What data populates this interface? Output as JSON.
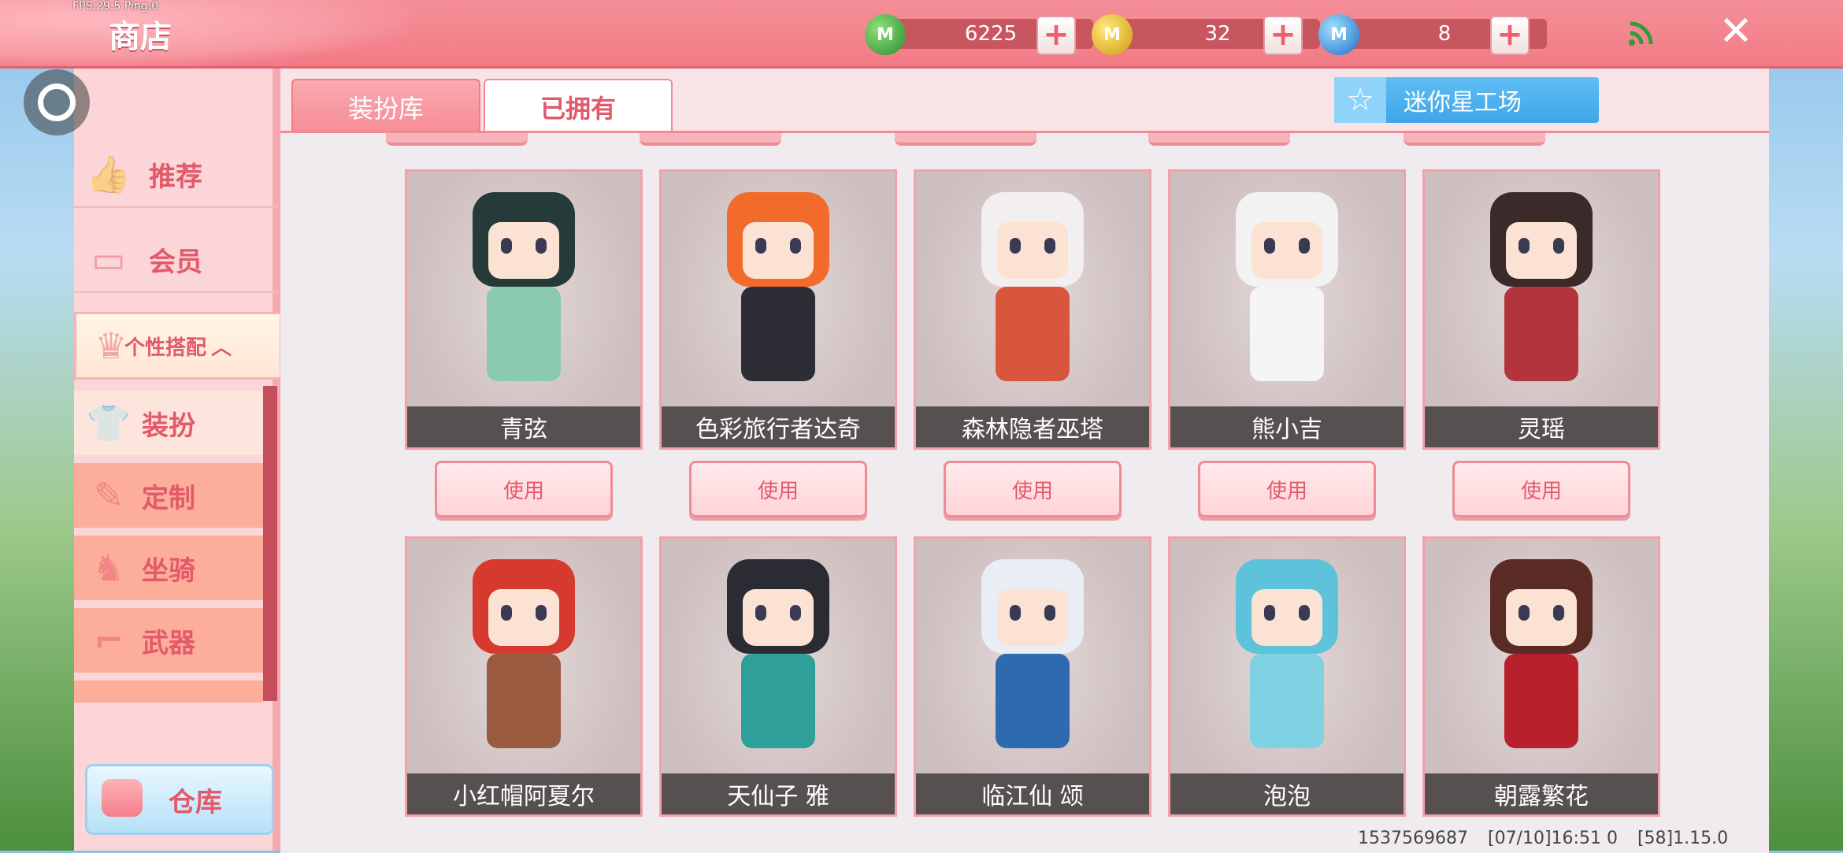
{
  "fps": "FPS:29.5 Ping:0",
  "header": {
    "title": "商店",
    "currencies": [
      {
        "icon": "mini-bean-coin-icon",
        "letter": "M",
        "value": "6225",
        "color": "#3daa3d"
      },
      {
        "icon": "mini-coin-icon",
        "letter": "M",
        "value": "32",
        "color": "#e6b91e"
      },
      {
        "icon": "mini-point-icon",
        "letter": "M",
        "value": "8",
        "color": "#2d8ce0"
      }
    ]
  },
  "sidebar": {
    "items": [
      {
        "label": "推荐",
        "icon": "thumbs-up-icon"
      },
      {
        "label": "会员",
        "icon": "member-card-icon"
      },
      {
        "label": "个性搭配",
        "icon": "style-icon"
      }
    ],
    "sub_items": [
      {
        "label": "装扮",
        "icon": "outfit-icon"
      },
      {
        "label": "定制",
        "icon": "brush-icon"
      },
      {
        "label": "坐骑",
        "icon": "mount-icon"
      },
      {
        "label": "武器",
        "icon": "gun-icon"
      }
    ],
    "warehouse": "仓库"
  },
  "tabs": {
    "t1": "装扮库",
    "t2": "已拥有"
  },
  "workshop": "迷你星工场",
  "use_label": "使用",
  "cards": [
    {
      "name": "青弦",
      "hair": "#253a39",
      "outfit": "#8cc9b1"
    },
    {
      "name": "色彩旅行者达奇",
      "hair": "#f26b2a",
      "outfit": "#2d2d36"
    },
    {
      "name": "森林隐者巫塔",
      "hair": "#f3eef0",
      "outfit": "#d8573c"
    },
    {
      "name": "熊小吉",
      "hair": "#f2f2f2",
      "outfit": "#f5f5f5"
    },
    {
      "name": "灵瑶",
      "hair": "#3a2a2a",
      "outfit": "#b3353b"
    },
    {
      "name": "小红帽阿夏尔",
      "hair": "#d63a2e",
      "outfit": "#9a5a40"
    },
    {
      "name": "天仙子 雅",
      "hair": "#2b2b33",
      "outfit": "#2f9f99"
    },
    {
      "name": "临江仙 颂",
      "hair": "#e9eef5",
      "outfit": "#2e6ab0"
    },
    {
      "name": "泡泡",
      "hair": "#5cc3db",
      "outfit": "#7fd2e2"
    },
    {
      "name": "朝露繁花",
      "hair": "#5a2a25",
      "outfit": "#b8202b"
    }
  ],
  "footer": {
    "uid": "1537569687",
    "time": "[07/10]16:51 0",
    "version": "[58]1.15.0"
  }
}
